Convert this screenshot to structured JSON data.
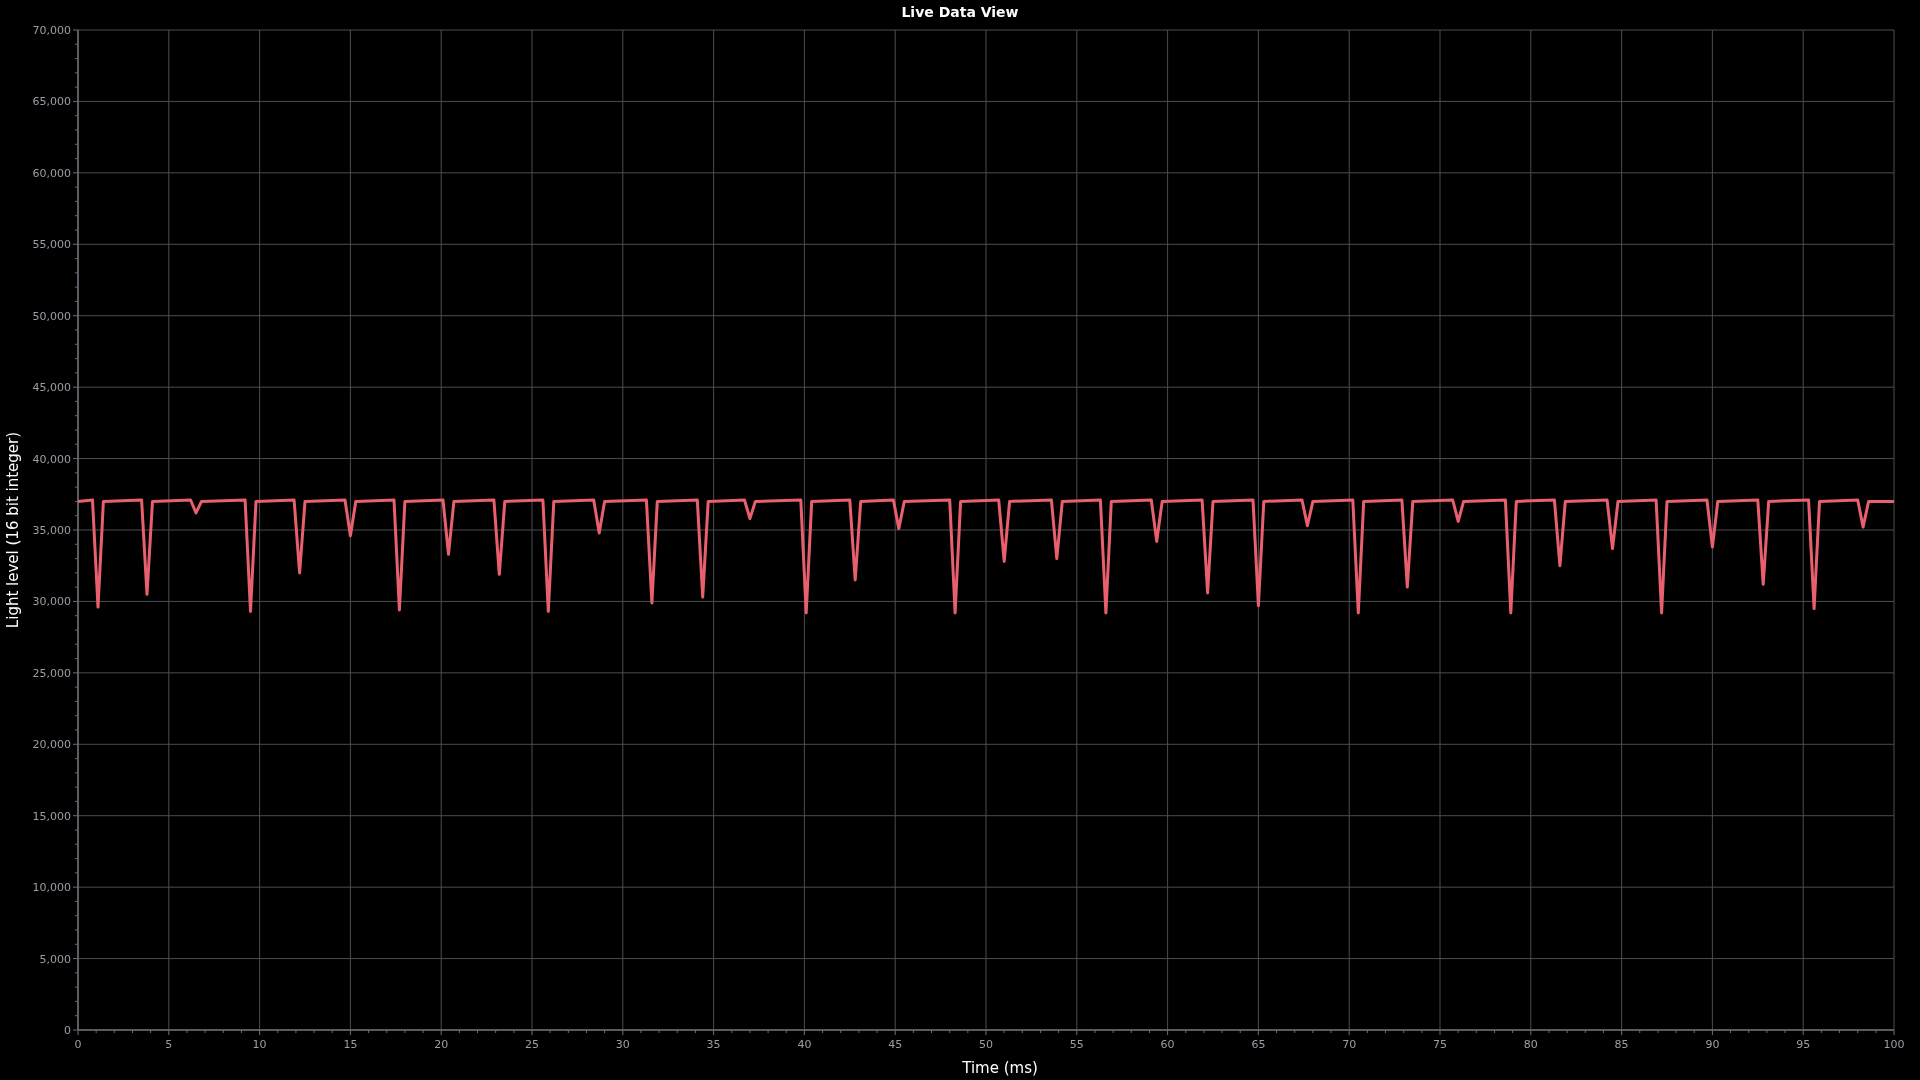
{
  "chart": {
    "chart_data": {
      "type": "line",
      "title": "Live Data View",
      "xlabel": "Time (ms)",
      "ylabel": "Light level (16 bit integer)",
      "grid": true,
      "xlim": [
        0,
        100
      ],
      "ylim": [
        0,
        70000
      ],
      "xticks": [
        0,
        5,
        10,
        15,
        20,
        25,
        30,
        35,
        40,
        45,
        50,
        55,
        60,
        65,
        70,
        75,
        80,
        85,
        90,
        95,
        100
      ],
      "yticks": [
        {
          "value": 0,
          "label": "0"
        },
        {
          "value": 5000,
          "label": "5,000"
        },
        {
          "value": 10000,
          "label": "10,000"
        },
        {
          "value": 15000,
          "label": "15,000"
        },
        {
          "value": 20000,
          "label": "20,000"
        },
        {
          "value": 25000,
          "label": "25,000"
        },
        {
          "value": 30000,
          "label": "30,000"
        },
        {
          "value": 35000,
          "label": "35,000"
        },
        {
          "value": 40000,
          "label": "40,000"
        },
        {
          "value": 45000,
          "label": "45,000"
        },
        {
          "value": 50000,
          "label": "50,000"
        },
        {
          "value": 55000,
          "label": "55,000"
        },
        {
          "value": 60000,
          "label": "60,000"
        },
        {
          "value": 65000,
          "label": "65,000"
        },
        {
          "value": 70000,
          "label": "70,000"
        }
      ],
      "x": [
        0,
        0.8,
        1.1,
        1.4,
        3.5,
        3.8,
        4.1,
        6.2,
        6.5,
        6.8,
        9.2,
        9.5,
        9.8,
        11.9,
        12.2,
        12.5,
        14.7,
        15.0,
        15.3,
        17.4,
        17.7,
        18.0,
        20.1,
        20.4,
        20.7,
        22.9,
        23.2,
        23.5,
        25.6,
        25.9,
        26.2,
        28.4,
        28.7,
        29.0,
        31.3,
        31.6,
        31.9,
        34.1,
        34.4,
        34.7,
        36.7,
        37.0,
        37.3,
        39.8,
        40.1,
        40.4,
        42.5,
        42.8,
        43.1,
        44.9,
        45.2,
        45.5,
        48.0,
        48.3,
        48.6,
        50.7,
        51.0,
        51.3,
        53.6,
        53.9,
        54.2,
        56.3,
        56.6,
        56.9,
        59.1,
        59.4,
        59.7,
        61.9,
        62.2,
        62.5,
        64.7,
        65.0,
        65.3,
        67.4,
        67.7,
        68.0,
        70.2,
        70.5,
        70.8,
        72.9,
        73.2,
        73.5,
        75.7,
        76.0,
        76.3,
        78.6,
        78.9,
        79.2,
        81.3,
        81.6,
        81.9,
        84.2,
        84.5,
        84.8,
        86.9,
        87.2,
        87.5,
        89.7,
        90.0,
        90.3,
        92.5,
        92.8,
        93.1,
        95.3,
        95.6,
        95.9,
        98.0,
        98.3,
        98.6,
        100
      ],
      "series": [
        {
          "color": "#e8606e",
          "values": [
            37000,
            37100,
            29600,
            37000,
            37100,
            30500,
            37000,
            37100,
            36200,
            37000,
            37100,
            29300,
            37000,
            37100,
            32000,
            37000,
            37100,
            34600,
            37000,
            37100,
            29400,
            37000,
            37100,
            33300,
            37000,
            37100,
            31900,
            37000,
            37100,
            29300,
            37000,
            37100,
            34800,
            37000,
            37100,
            29900,
            37000,
            37100,
            30300,
            37000,
            37100,
            35800,
            37000,
            37100,
            29200,
            37000,
            37100,
            31500,
            37000,
            37100,
            35100,
            37000,
            37100,
            29200,
            37000,
            37100,
            32800,
            37000,
            37100,
            33000,
            37000,
            37100,
            29200,
            37000,
            37100,
            34200,
            37000,
            37100,
            30600,
            37000,
            37100,
            29700,
            37000,
            37100,
            35300,
            37000,
            37100,
            29200,
            37000,
            37100,
            31000,
            37000,
            37100,
            35600,
            37000,
            37100,
            29200,
            37000,
            37100,
            32500,
            37000,
            37100,
            33700,
            37000,
            37100,
            29200,
            37000,
            37100,
            33800,
            37000,
            37100,
            31200,
            37000,
            37100,
            29500,
            37000,
            37100,
            35200,
            37000,
            37000
          ]
        }
      ]
    }
  }
}
